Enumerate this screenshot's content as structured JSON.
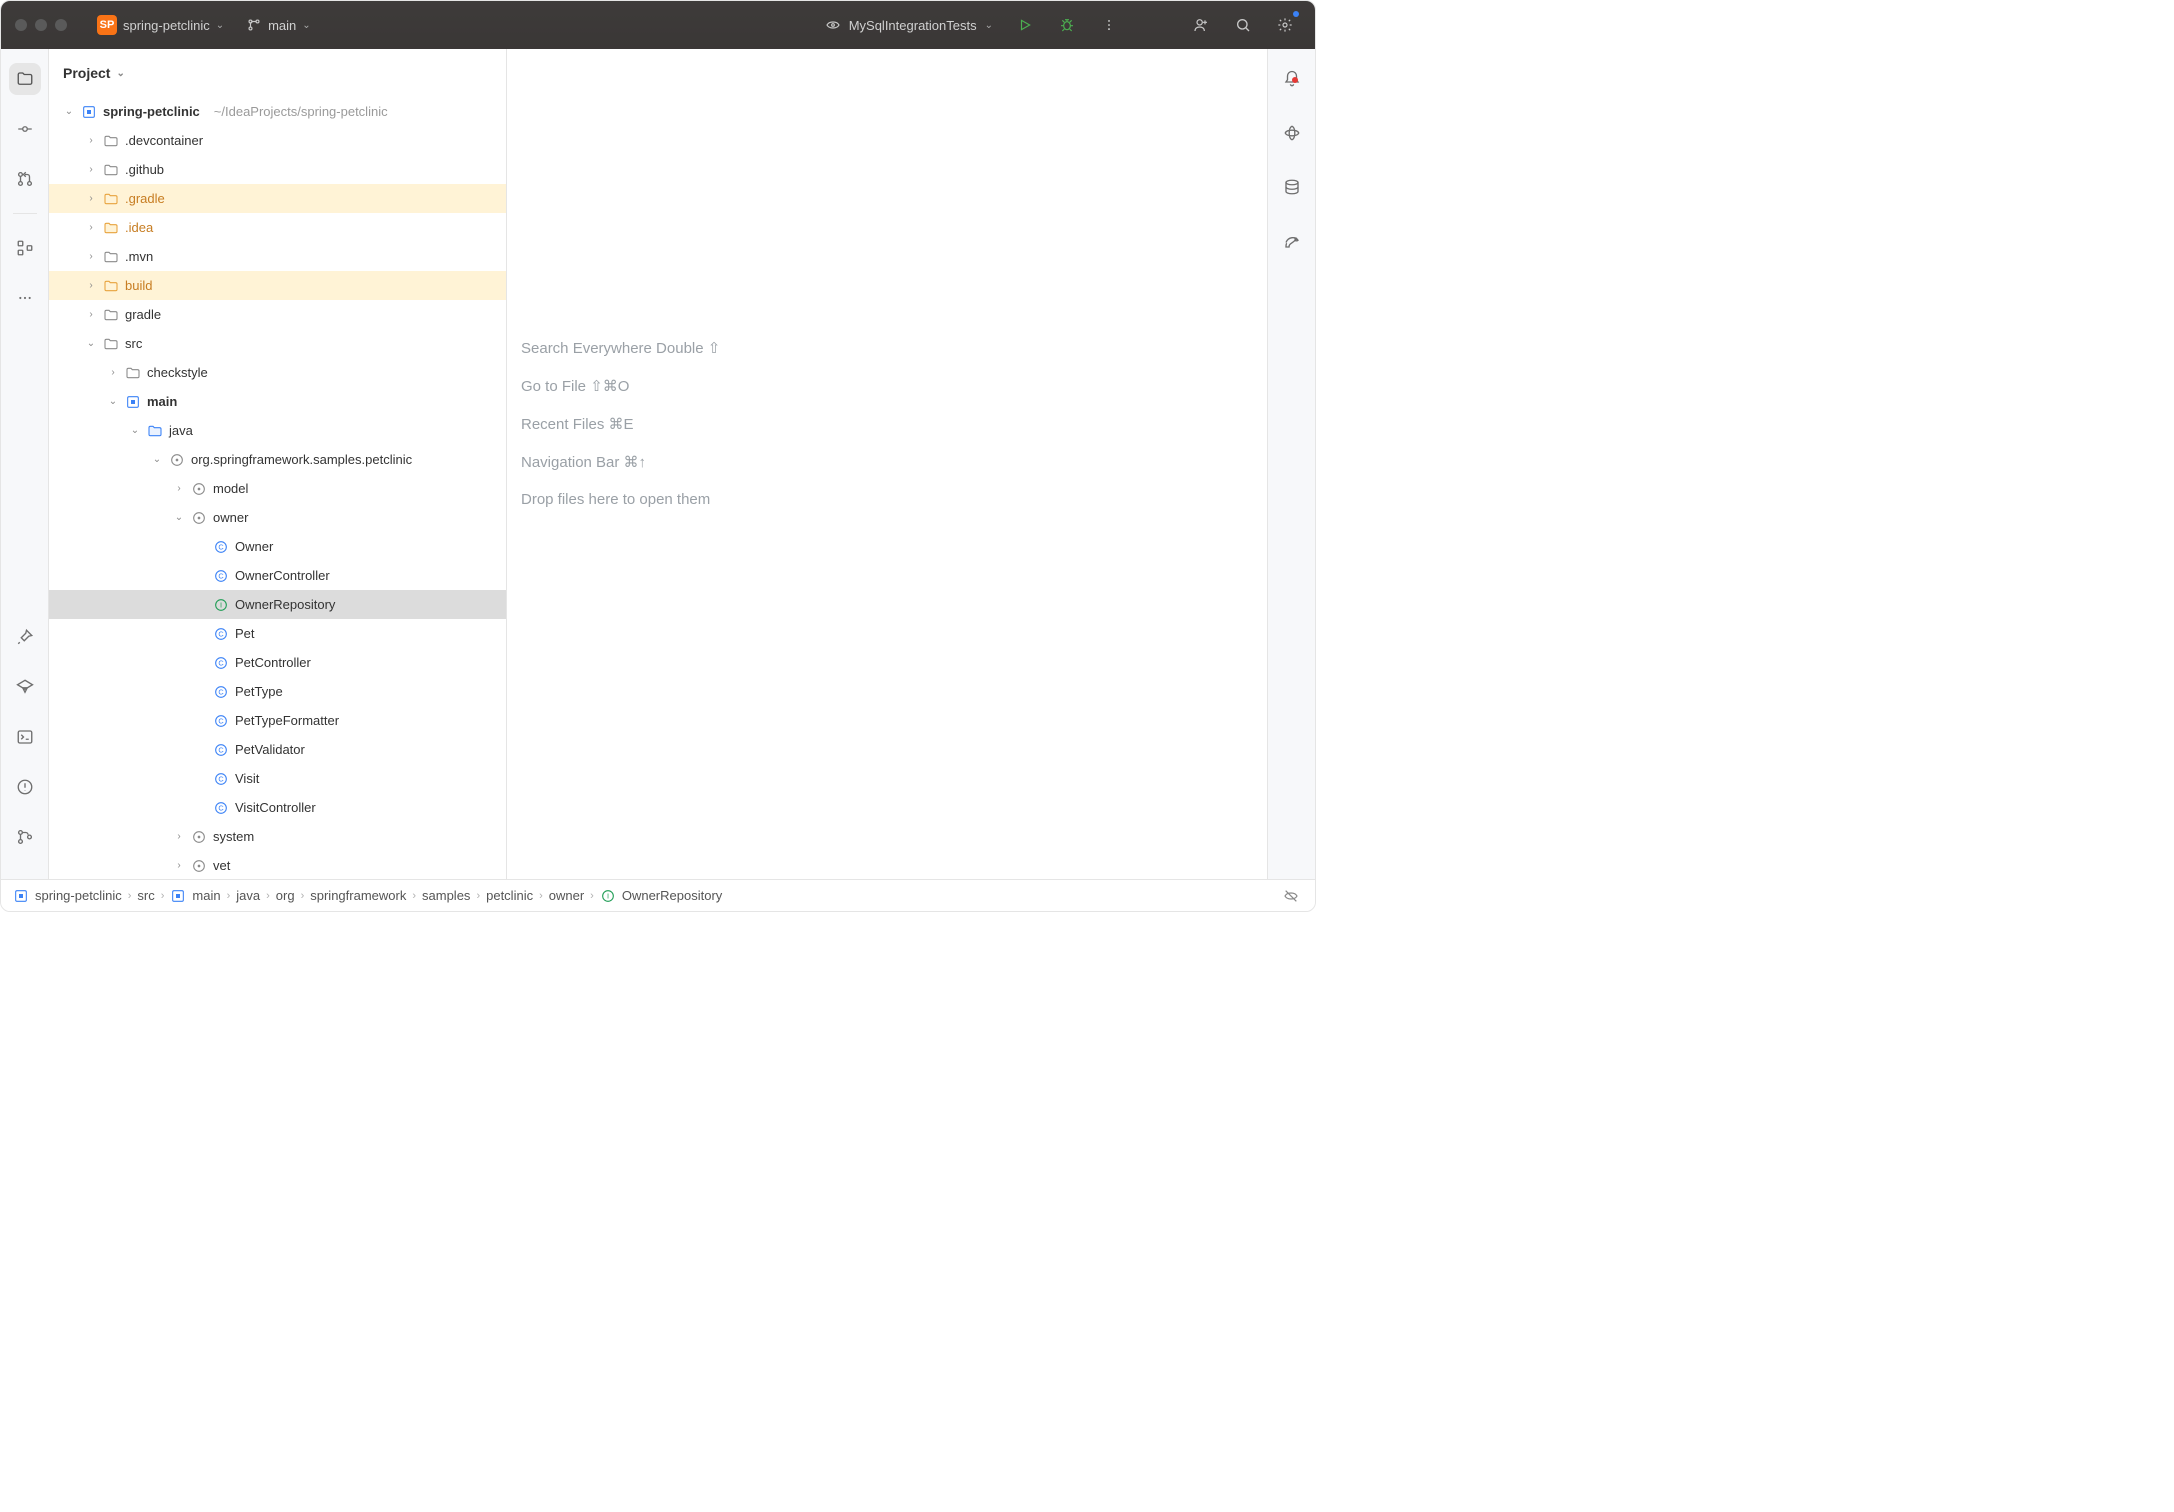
{
  "titlebar": {
    "project_badge": "SP",
    "project_name": "spring-petclinic",
    "branch": "main",
    "run_config": "MySqlIntegrationTests"
  },
  "project_pane": {
    "header": "Project",
    "tree": [
      {
        "indent": 0,
        "arrow": "down",
        "icon": "module",
        "label": "spring-petclinic",
        "bold": true,
        "aux": "~/IdeaProjects/spring-petclinic"
      },
      {
        "indent": 1,
        "arrow": "right",
        "icon": "folder",
        "label": ".devcontainer"
      },
      {
        "indent": 1,
        "arrow": "right",
        "icon": "folder",
        "label": ".github"
      },
      {
        "indent": 1,
        "arrow": "right",
        "icon": "folder-ex",
        "label": ".gradle",
        "dim": true,
        "hinted": true
      },
      {
        "indent": 1,
        "arrow": "right",
        "icon": "folder-ex",
        "label": ".idea",
        "dim": true
      },
      {
        "indent": 1,
        "arrow": "right",
        "icon": "folder",
        "label": ".mvn"
      },
      {
        "indent": 1,
        "arrow": "right",
        "icon": "folder-ex",
        "label": "build",
        "dim": true,
        "hinted": true
      },
      {
        "indent": 1,
        "arrow": "right",
        "icon": "folder",
        "label": "gradle"
      },
      {
        "indent": 1,
        "arrow": "down",
        "icon": "folder",
        "label": "src"
      },
      {
        "indent": 2,
        "arrow": "right",
        "icon": "folder",
        "label": "checkstyle"
      },
      {
        "indent": 2,
        "arrow": "down",
        "icon": "module",
        "label": "main",
        "bold": true
      },
      {
        "indent": 3,
        "arrow": "down",
        "icon": "folder-src",
        "label": "java"
      },
      {
        "indent": 4,
        "arrow": "down",
        "icon": "package",
        "label": "org.springframework.samples.petclinic"
      },
      {
        "indent": 5,
        "arrow": "right",
        "icon": "package",
        "label": "model"
      },
      {
        "indent": 5,
        "arrow": "down",
        "icon": "package",
        "label": "owner"
      },
      {
        "indent": 6,
        "arrow": "none",
        "icon": "class",
        "label": "Owner"
      },
      {
        "indent": 6,
        "arrow": "none",
        "icon": "class",
        "label": "OwnerController"
      },
      {
        "indent": 6,
        "arrow": "none",
        "icon": "interface",
        "label": "OwnerRepository",
        "selected": true
      },
      {
        "indent": 6,
        "arrow": "none",
        "icon": "class",
        "label": "Pet"
      },
      {
        "indent": 6,
        "arrow": "none",
        "icon": "class",
        "label": "PetController"
      },
      {
        "indent": 6,
        "arrow": "none",
        "icon": "class",
        "label": "PetType"
      },
      {
        "indent": 6,
        "arrow": "none",
        "icon": "class",
        "label": "PetTypeFormatter"
      },
      {
        "indent": 6,
        "arrow": "none",
        "icon": "class",
        "label": "PetValidator"
      },
      {
        "indent": 6,
        "arrow": "none",
        "icon": "class",
        "label": "Visit"
      },
      {
        "indent": 6,
        "arrow": "none",
        "icon": "class",
        "label": "VisitController"
      },
      {
        "indent": 5,
        "arrow": "right",
        "icon": "package",
        "label": "system"
      },
      {
        "indent": 5,
        "arrow": "right",
        "icon": "package",
        "label": "vet"
      }
    ]
  },
  "editor_hints": [
    "Search Everywhere Double ⇧",
    "Go to File ⇧⌘O",
    "Recent Files ⌘E",
    "Navigation Bar ⌘↑",
    "Drop files here to open them"
  ],
  "breadcrumbs": [
    {
      "icon": "module",
      "label": "spring-petclinic"
    },
    {
      "icon": null,
      "label": "src"
    },
    {
      "icon": "module",
      "label": "main"
    },
    {
      "icon": null,
      "label": "java"
    },
    {
      "icon": null,
      "label": "org"
    },
    {
      "icon": null,
      "label": "springframework"
    },
    {
      "icon": null,
      "label": "samples"
    },
    {
      "icon": null,
      "label": "petclinic"
    },
    {
      "icon": null,
      "label": "owner"
    },
    {
      "icon": "interface",
      "label": "OwnerRepository"
    }
  ]
}
